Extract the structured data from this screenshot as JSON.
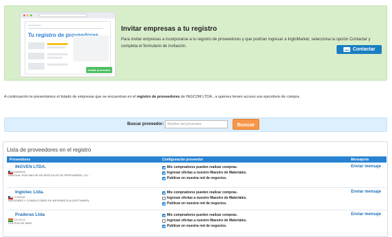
{
  "promo": {
    "mock": {
      "crumb": "Ingresa/Volver ...",
      "title": "Tu registro de proveedores",
      "button": "Invitar proveedor"
    },
    "title": "Invitar empresas a tu registro",
    "text": "Para invitar empresas a incorporarse a tu registro de proveedores y que podrían ingresar a IngloMarket, selecciona la opción Contactar y completa el formulario de invitación.",
    "contact_button": "Contactar"
  },
  "intro": {
    "before": "A continuación te presentamos el listado de empresas que se encuentran en el ",
    "bold": "registro de proveedores",
    "after": " de INGCOM LTDA., a quienes tienen acceso sus ejecutivos de compra."
  },
  "search": {
    "label": "Buscar proveedor:",
    "placeholder": "Nombre del proveedor",
    "button": "Buscar"
  },
  "list": {
    "title": "Lista de proveedores en el registro",
    "columns": [
      "Proveedores",
      "Configuración proveedor",
      "Mensajería"
    ],
    "option_labels": [
      "Mis compradores pueden realizar compras.",
      "Ingresar ofertas a nuestro Maestro de Materiales.",
      "Publicar en nuestra red de negocios."
    ],
    "rows": [
      {
        "name": "INGVEN LTDA.",
        "id": "CH-59888606",
        "desc": "VENTA AL POR MAYOR DE ARTÍCULOS DE PERFUMERÍA, CO...",
        "flag": "cl",
        "options": [
          true,
          true,
          true
        ],
        "message": "Enviar mensaje"
      },
      {
        "name": "Inglotec Ltda.",
        "id": "CH-77054680",
        "desc": "ASESORES Y CONSULTORES EN INFORMÁTICA (SOFTWARE)",
        "flag": "cl",
        "options": [
          true,
          false,
          true
        ],
        "message": "Enviar mensaje"
      },
      {
        "name": "Praderas Ltda",
        "id": "BO-12123443",
        "desc": "CULTIVO DE MAIZ",
        "flag": "bo",
        "options": [
          true,
          false,
          true
        ],
        "message": "Enviar mensaje"
      }
    ]
  }
}
